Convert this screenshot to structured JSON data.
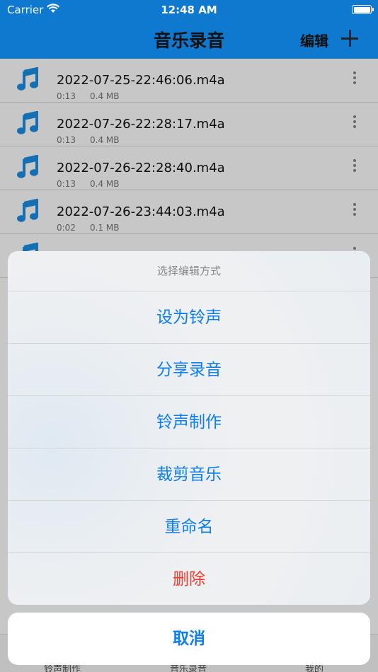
{
  "status_bar": {
    "carrier": "Carrier",
    "time": "12:48 AM"
  },
  "nav": {
    "title": "音乐录音",
    "edit_label": "编辑"
  },
  "recordings": [
    {
      "name": "2022-07-25-22:46:06.m4a",
      "duration": "0:13",
      "size": "0.4 MB"
    },
    {
      "name": "2022-07-26-22:28:17.m4a",
      "duration": "0:13",
      "size": "0.4 MB"
    },
    {
      "name": "2022-07-26-22:28:40.m4a",
      "duration": "0:13",
      "size": "0.4 MB"
    },
    {
      "name": "2022-07-26-23:44:03.m4a",
      "duration": "0:02",
      "size": "0.1 MB"
    }
  ],
  "tabbar": {
    "tabs": [
      "铃声制作",
      "音乐录音",
      "我的"
    ]
  },
  "action_sheet": {
    "title": "选择编辑方式",
    "options": [
      "设为铃声",
      "分享录音",
      "铃声制作",
      "裁剪音乐",
      "重命名"
    ],
    "destructive": "删除",
    "cancel": "取消"
  },
  "colors": {
    "nav_blue": "#0f79d0",
    "action_blue": "#0d7ef0",
    "destructive_red": "#f23a2f",
    "icon_blue": "#1a8fe6"
  }
}
